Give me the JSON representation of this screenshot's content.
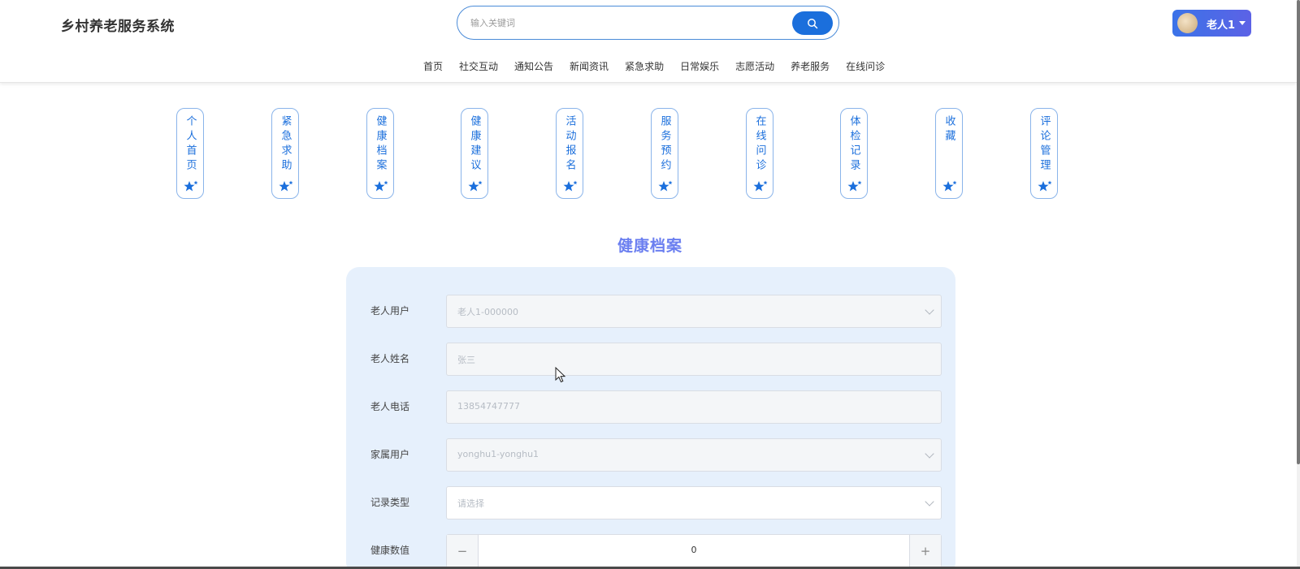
{
  "header": {
    "brand": "乡村养老服务系统",
    "search_placeholder": "输入关键词",
    "user_name": "老人1"
  },
  "nav": [
    "首页",
    "社交互动",
    "通知公告",
    "新闻资讯",
    "紧急求助",
    "日常娱乐",
    "志愿活动",
    "养老服务",
    "在线问诊"
  ],
  "tabs": [
    {
      "label": "个人首页"
    },
    {
      "label": "紧急求助"
    },
    {
      "label": "健康档案"
    },
    {
      "label": "健康建议"
    },
    {
      "label": "活动报名"
    },
    {
      "label": "服务预约"
    },
    {
      "label": "在线问诊"
    },
    {
      "label": "体检记录"
    },
    {
      "label": "收藏"
    },
    {
      "label": "评论管理"
    }
  ],
  "page": {
    "title": "健康档案"
  },
  "form": {
    "elder_user_label": "老人用户",
    "elder_user_value": "老人1-000000",
    "elder_name_label": "老人姓名",
    "elder_name_value": "张三",
    "elder_phone_label": "老人电话",
    "elder_phone_value": "13854747777",
    "family_user_label": "家属用户",
    "family_user_value": "yonghu1-yonghu1",
    "record_type_label": "记录类型",
    "record_type_placeholder": "请选择",
    "health_value_label": "健康数值",
    "health_value": "0",
    "minus": "−",
    "plus": "+"
  },
  "colors": {
    "primary": "#1b6fdc",
    "title": "#6b7ff0",
    "panel": "#e6f0fc"
  }
}
